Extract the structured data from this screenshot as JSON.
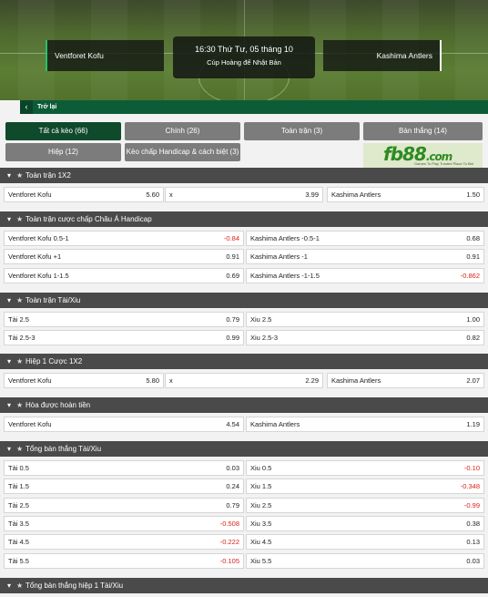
{
  "match": {
    "home": "Ventforet Kofu",
    "away": "Kashima Antlers",
    "time": "16:30 Thứ Tư, 05 tháng 10",
    "competition": "Cúp Hoàng đế Nhật Bản",
    "back": "Trở lại"
  },
  "tabs": [
    {
      "label": "Tất cả kèo (66)"
    },
    {
      "label": "Chính (26)"
    },
    {
      "label": "Toàn trận (3)"
    },
    {
      "label": "Bàn thắng (14)"
    },
    {
      "label": "Hiệp (12)"
    },
    {
      "label": "Kèo chấp Handicap & cách biệt (3)"
    }
  ],
  "promo": {
    "logo": "fb88",
    "suffix": ".com",
    "tagline": "Games To Play  Trusted Place To Bet"
  },
  "sections": [
    {
      "title": "Toàn trận 1X2",
      "rows": [
        [
          {
            "l": "Ventforet Kofu",
            "v": "5.60"
          },
          {
            "l": "x",
            "v": "3.99"
          },
          {
            "l": "Kashima Antlers",
            "v": "1.50"
          }
        ]
      ]
    },
    {
      "title": "Toàn trận cược chấp Châu Á Handicap",
      "rows": [
        [
          {
            "l": "Ventforet Kofu 0.5-1",
            "v": "-0.84"
          },
          {
            "l": "Kashima Antlers -0.5-1",
            "v": "0.68"
          }
        ],
        [
          {
            "l": "Ventforet Kofu +1",
            "v": "0.91"
          },
          {
            "l": "Kashima Antlers -1",
            "v": "0.91"
          }
        ],
        [
          {
            "l": "Ventforet Kofu 1-1.5",
            "v": "0.69"
          },
          {
            "l": "Kashima Antlers -1-1.5",
            "v": "-0.862"
          }
        ]
      ]
    },
    {
      "title": "Toàn trận Tài/Xiu",
      "rows": [
        [
          {
            "l": "Tài 2.5",
            "v": "0.79"
          },
          {
            "l": "Xiu 2.5",
            "v": "1.00"
          }
        ],
        [
          {
            "l": "Tài 2.5-3",
            "v": "0.99"
          },
          {
            "l": "Xiu 2.5-3",
            "v": "0.82"
          }
        ]
      ]
    },
    {
      "title": "Hiệp 1 Cược 1X2",
      "rows": [
        [
          {
            "l": "Ventforet Kofu",
            "v": "5.80"
          },
          {
            "l": "x",
            "v": "2.29"
          },
          {
            "l": "Kashima Antlers",
            "v": "2.07"
          }
        ]
      ]
    },
    {
      "title": "Hòa được hoàn tiền",
      "rows": [
        [
          {
            "l": "Ventforet Kofu",
            "v": "4.54"
          },
          {
            "l": "Kashima Antlers",
            "v": "1.19"
          }
        ]
      ]
    },
    {
      "title": "Tổng bàn thắng Tài/Xiu",
      "rows": [
        [
          {
            "l": "Tài 0.5",
            "v": "0.03"
          },
          {
            "l": "Xiu 0.5",
            "v": "-0.10"
          }
        ],
        [
          {
            "l": "Tài 1.5",
            "v": "0.24"
          },
          {
            "l": "Xiu 1.5",
            "v": "-0.348"
          }
        ],
        [
          {
            "l": "Tài 2.5",
            "v": "0.79"
          },
          {
            "l": "Xiu 2.5",
            "v": "-0.99"
          }
        ],
        [
          {
            "l": "Tài 3.5",
            "v": "-0.508"
          },
          {
            "l": "Xiu 3.5",
            "v": "0.38"
          }
        ],
        [
          {
            "l": "Tài 4.5",
            "v": "-0.222"
          },
          {
            "l": "Xiu 4.5",
            "v": "0.13"
          }
        ],
        [
          {
            "l": "Tài 5.5",
            "v": "-0.105"
          },
          {
            "l": "Xiu 5.5",
            "v": "0.03"
          }
        ]
      ]
    },
    {
      "title": "Tổng bàn thắng hiệp 1 Tài/Xiu",
      "rows": []
    }
  ]
}
